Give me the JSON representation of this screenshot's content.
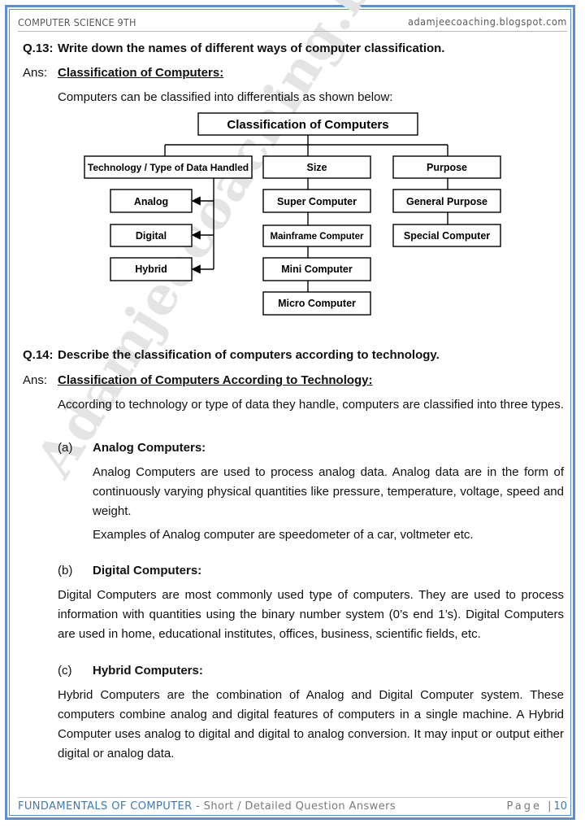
{
  "header": {
    "left": "COMPUTER SCIENCE 9TH",
    "right": "adamjeecoaching.blogspot.com"
  },
  "footer": {
    "subject": "FUNDAMENTALS OF COMPUTER",
    "subtitle": " - Short / Detailed Question Answers",
    "page_label": "Page |",
    "page_number": "10"
  },
  "watermark": "Adamjeecoaching.blogspot.com",
  "q13": {
    "label": "Q.13:",
    "question": "Write down the names of different ways of computer classification.",
    "ans_label": "Ans:",
    "heading": "Classification of Computers:",
    "intro": "Computers can be classified into differentials as shown below:"
  },
  "diagram": {
    "root": "Classification of Computers",
    "branches": [
      {
        "label": "Technology / Type of Data Handled",
        "children": [
          "Analog",
          "Digital",
          "Hybrid"
        ]
      },
      {
        "label": "Size",
        "children": [
          "Super Computer",
          "Mainframe Computer",
          "Mini Computer",
          "Micro Computer"
        ]
      },
      {
        "label": "Purpose",
        "children": [
          "General Purpose",
          "Special Computer"
        ]
      }
    ]
  },
  "q14": {
    "label": "Q.14:",
    "question": "Describe the classification of computers according to technology.",
    "ans_label": "Ans:",
    "heading": "Classification of Computers According to Technology:",
    "intro": "According to technology or type of data they handle, computers are classified into three types.",
    "sections": [
      {
        "marker": "(a)",
        "title": "Analog Computers:",
        "paragraphs": [
          "Analog Computers are used to process analog data. Analog data are in the form of continuously varying physical quantities like pressure, temperature, voltage, speed and weight.",
          "Examples of Analog computer are speedometer of a car, voltmeter etc."
        ]
      },
      {
        "marker": "(b)",
        "title": "Digital Computers:",
        "paragraphs": [
          "Digital Computers are most commonly used type of computers. They are used to process information with quantities using the binary number system (0’s end 1’s). Digital Computers are used in home, educational institutes, offices, business, scientific fields, etc."
        ]
      },
      {
        "marker": "(c)",
        "title": "Hybrid Computers:",
        "paragraphs": [
          "Hybrid Computers are the combination of Analog and Digital Computer system. These computers combine analog and digital features of computers in a single machine. A Hybrid Computer uses analog to digital and digital to analog conversion. It may input or output either digital or analog data."
        ]
      }
    ]
  }
}
